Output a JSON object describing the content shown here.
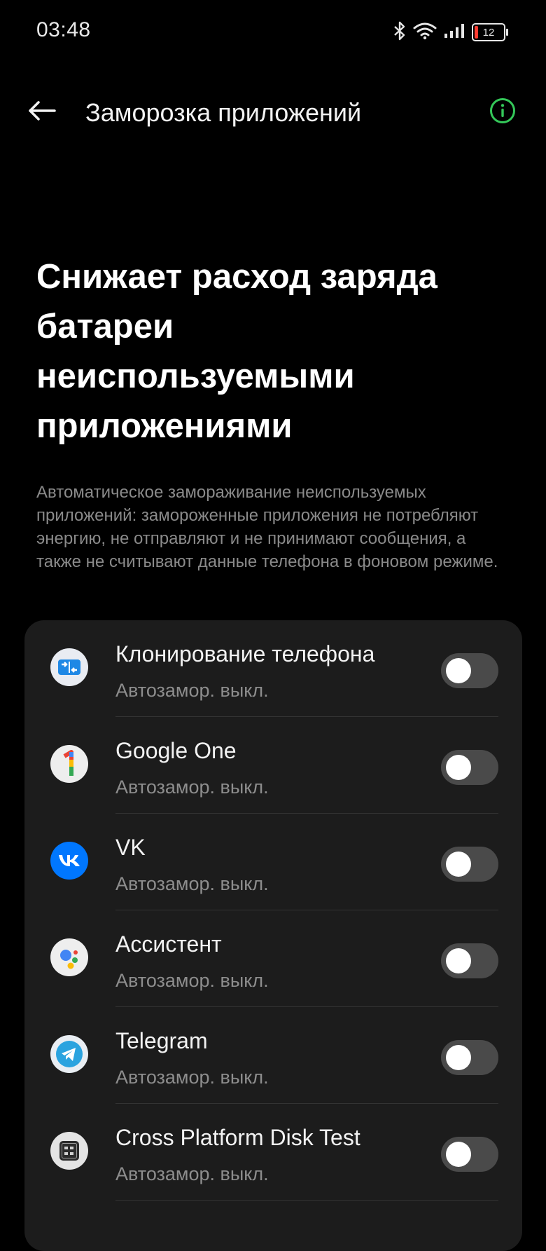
{
  "status_bar": {
    "time": "03:48",
    "battery_percent": "12",
    "icons": [
      "bluetooth-icon",
      "wifi-icon",
      "signal-icon",
      "battery-icon"
    ]
  },
  "app_bar": {
    "title": "Заморозка приложений",
    "back_icon": "arrow-left-icon",
    "info_icon": "info-circle-icon",
    "accent_color": "#34c759"
  },
  "hero": {
    "title": "Снижает расход заряда батареи неиспользуемыми приложениями",
    "description": "Автоматическое замораживание неиспользуемых приложений: замороженные приложения не потребляют энергию, не отправляют и не принимают сообщения, а также не считывают данные телефона в фоновом режиме."
  },
  "apps": [
    {
      "name": "Клонирование телефона",
      "status": "Автозамор. выкл.",
      "icon": "phone-clone-icon",
      "enabled": false
    },
    {
      "name": "Google One",
      "status": "Автозамор. выкл.",
      "icon": "google-one-icon",
      "enabled": false
    },
    {
      "name": "VK",
      "status": "Автозамор. выкл.",
      "icon": "vk-icon",
      "enabled": false
    },
    {
      "name": "Ассистент",
      "status": "Автозамор. выкл.",
      "icon": "assistant-icon",
      "enabled": false
    },
    {
      "name": "Telegram",
      "status": "Автозамор. выкл.",
      "icon": "telegram-icon",
      "enabled": false
    },
    {
      "name": "Cross Platform Disk Test",
      "status": "Автозамор. выкл.",
      "icon": "cpdt-icon",
      "enabled": false
    }
  ]
}
